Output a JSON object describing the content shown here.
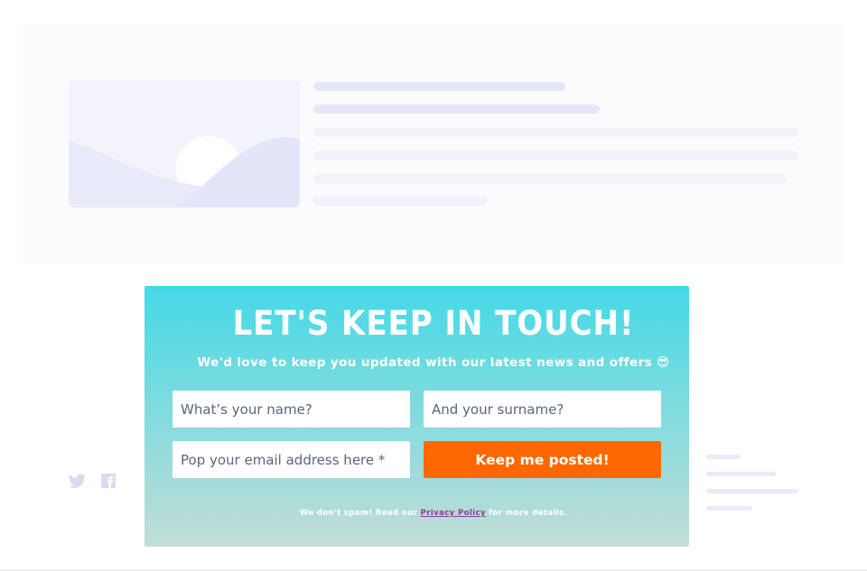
{
  "newsletter": {
    "title": "LET'S KEEP IN TOUCH!",
    "subtitle": "We'd love to keep you updated with our latest news and offers",
    "emoji": "😎",
    "name_placeholder": "What’s your name?",
    "surname_placeholder": "And your surname?",
    "email_placeholder": "Pop your email address here *",
    "submit_label": "Keep me posted!",
    "disclaimer_prefix": "We don't spam! Read our",
    "privacy_link": "Privacy Policy",
    "disclaimer_suffix": "for more details."
  },
  "social": {
    "icons": [
      "twitter-icon",
      "facebook-icon"
    ]
  },
  "colors": {
    "accent": "#ff6700",
    "gradient_top": "#44dae6",
    "gradient_bottom": "#c3ddd5",
    "skeleton": "#e4e7f8",
    "link": "#8e3c8e"
  }
}
